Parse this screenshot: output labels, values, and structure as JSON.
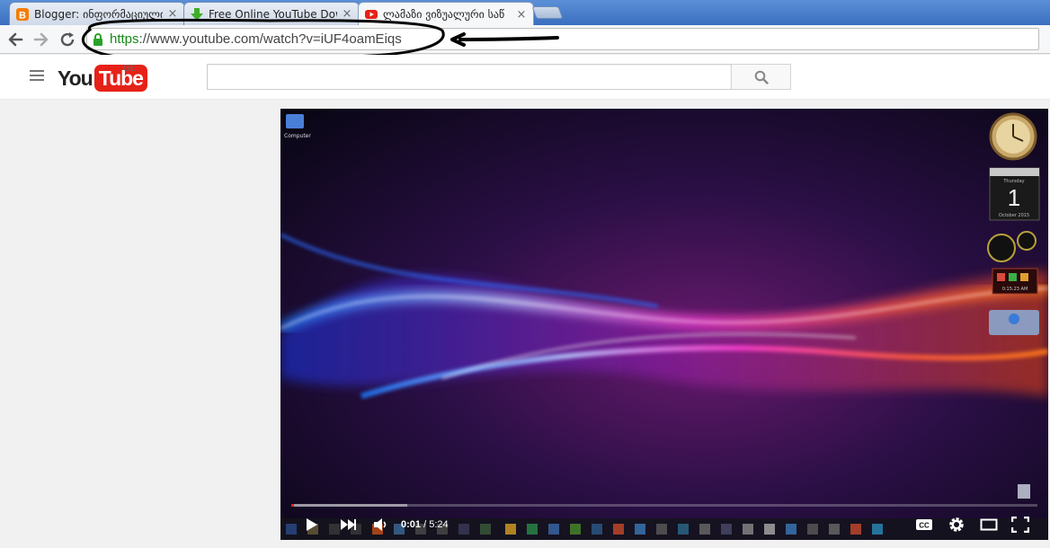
{
  "browser": {
    "tabs": [
      {
        "title": "Blogger: ინფორმაციული",
        "favicon": "blogger-icon",
        "active": false
      },
      {
        "title": "Free Online YouTube Dow",
        "favicon": "download-arrow-icon",
        "active": false
      },
      {
        "title": "ლამაზი ვიზუალური საწ",
        "favicon": "youtube-icon",
        "active": true
      }
    ],
    "close_glyph": "×",
    "url_scheme": "https",
    "url_rest": "://www.youtube.com/watch?v=iUF4oamEiqs"
  },
  "youtube": {
    "logo_you": "You",
    "logo_tube": "Tube",
    "region": "GE",
    "search_placeholder": ""
  },
  "player": {
    "current_time": "0:01",
    "separator": " / ",
    "duration": "5:24",
    "played_fraction": 0.003,
    "buffered_fraction": 0.155,
    "desktop_icon_label": "Computer",
    "calendar_day_name": "Thursday",
    "calendar_day": "1",
    "calendar_month_year": "October 2015",
    "clock_readout": "0:15:23 AM"
  },
  "colors": {
    "youtube_red": "#e62117",
    "secure_green": "#168a16",
    "annotation": "#000000"
  }
}
